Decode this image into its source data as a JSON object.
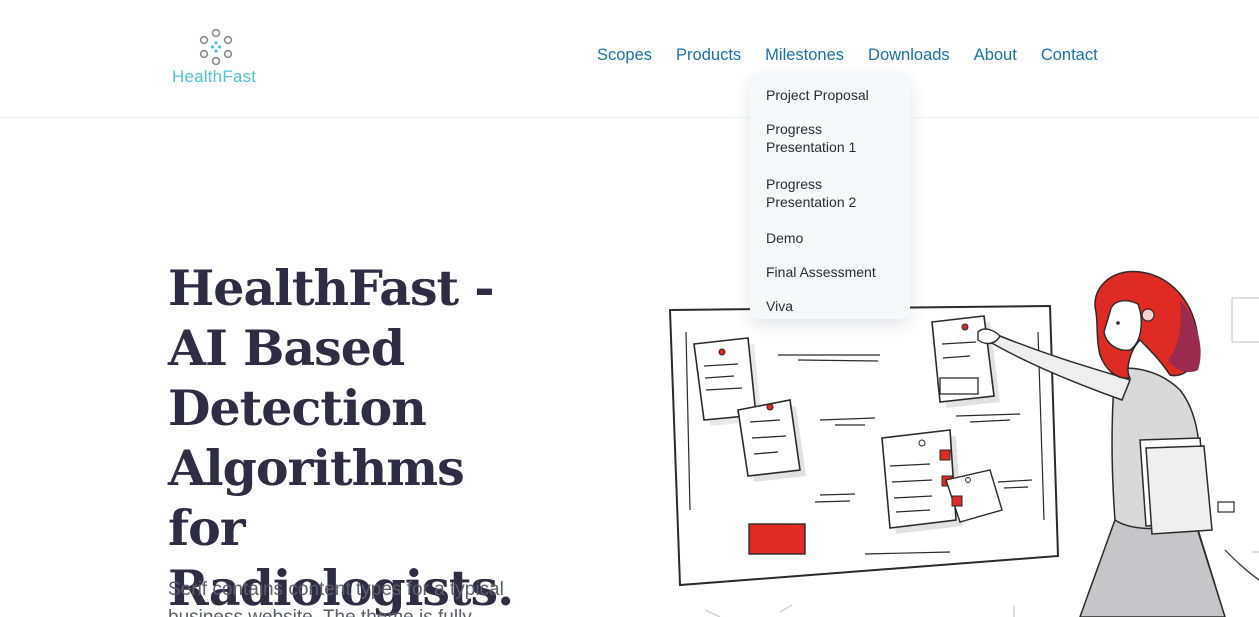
{
  "brand": {
    "name": "HealthFast"
  },
  "nav": {
    "items": [
      "Scopes",
      "Products",
      "Milestones",
      "Downloads",
      "About",
      "Contact"
    ]
  },
  "milestones_menu": {
    "items": [
      "Project Proposal",
      "Progress Presentation 1",
      "Progress Presentation 2",
      "Demo",
      "Final Assessment",
      "Viva"
    ]
  },
  "hero": {
    "title": "HealthFast - AI Based Detection Algorithms for Radiologists.",
    "description": "Serif contains content types for a typical business website. The theme is fully"
  },
  "colors": {
    "nav_link": "#1a73a8",
    "logo": "#4fc3d4",
    "title": "#2e2d44",
    "accent_red": "#e02a24"
  }
}
